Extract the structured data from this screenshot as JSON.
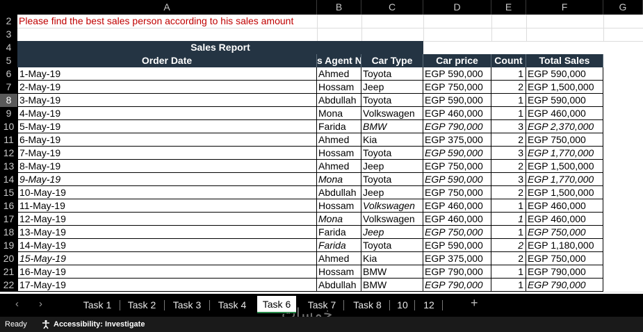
{
  "columns": [
    "A",
    "B",
    "C",
    "D",
    "E",
    "F",
    "G"
  ],
  "instruction": "Please find the best sales person according to his sales amount",
  "report_title": "Sales Report",
  "headers": [
    "Order Date",
    "s Agent N",
    "Car Type",
    "Car price",
    "Count",
    "Total Sales"
  ],
  "rows": [
    {
      "num": "6",
      "date": "1-May-19",
      "agent": "Ahmed",
      "car": "Toyota",
      "price": "EGP 590,000",
      "count": "1",
      "total": "EGP 590,000",
      "it": []
    },
    {
      "num": "7",
      "date": "2-May-19",
      "agent": "Hossam",
      "car": "Jeep",
      "price": "EGP 750,000",
      "count": "2",
      "total": "EGP 1,500,000",
      "it": []
    },
    {
      "num": "8",
      "date": "3-May-19",
      "agent": "Abdullah",
      "car": "Toyota",
      "price": "EGP 590,000",
      "count": "1",
      "total": "EGP 590,000",
      "it": []
    },
    {
      "num": "9",
      "date": "4-May-19",
      "agent": "Mona",
      "car": "Volkswagen",
      "price": "EGP 460,000",
      "count": "1",
      "total": "EGP 460,000",
      "it": []
    },
    {
      "num": "10",
      "date": "5-May-19",
      "agent": "Farida",
      "car": "BMW",
      "price": "EGP 790,000",
      "count": "3",
      "total": "EGP 2,370,000",
      "it": [
        "car",
        "price",
        "total"
      ]
    },
    {
      "num": "11",
      "date": "6-May-19",
      "agent": "Ahmed",
      "car": "Kia",
      "price": "EGP 375,000",
      "count": "2",
      "total": "EGP 750,000",
      "it": []
    },
    {
      "num": "12",
      "date": "7-May-19",
      "agent": "Hossam",
      "car": "Toyota",
      "price": "EGP 590,000",
      "count": "3",
      "total": "EGP 1,770,000",
      "it": [
        "price",
        "total"
      ]
    },
    {
      "num": "13",
      "date": "8-May-19",
      "agent": "Ahmed",
      "car": "Jeep",
      "price": "EGP 750,000",
      "count": "2",
      "total": "EGP 1,500,000",
      "it": []
    },
    {
      "num": "14",
      "date": "9-May-19",
      "agent": "Mona",
      "car": "Toyota",
      "price": "EGP 590,000",
      "count": "3",
      "total": "EGP 1,770,000",
      "it": [
        "date",
        "agent",
        "price",
        "total"
      ]
    },
    {
      "num": "15",
      "date": "10-May-19",
      "agent": "Abdullah",
      "car": "Jeep",
      "price": "EGP 750,000",
      "count": "2",
      "total": "EGP 1,500,000",
      "it": []
    },
    {
      "num": "16",
      "date": "11-May-19",
      "agent": "Hossam",
      "car": "Volkswagen",
      "price": "EGP 460,000",
      "count": "1",
      "total": "EGP 460,000",
      "it": [
        "car"
      ]
    },
    {
      "num": "17",
      "date": "12-May-19",
      "agent": "Mona",
      "car": "Volkswagen",
      "price": "EGP 460,000",
      "count": "1",
      "total": "EGP 460,000",
      "it": [
        "agent",
        "count"
      ]
    },
    {
      "num": "18",
      "date": "13-May-19",
      "agent": "Farida",
      "car": "Jeep",
      "price": "EGP 750,000",
      "count": "1",
      "total": "EGP 750,000",
      "it": [
        "car",
        "price",
        "total"
      ]
    },
    {
      "num": "19",
      "date": "14-May-19",
      "agent": "Farida",
      "car": "Toyota",
      "price": "EGP 590,000",
      "count": "2",
      "total": "EGP 1,180,000",
      "it": [
        "agent",
        "count"
      ]
    },
    {
      "num": "20",
      "date": "15-May-19",
      "agent": "Ahmed",
      "car": "Kia",
      "price": "EGP 375,000",
      "count": "2",
      "total": "EGP 750,000",
      "it": [
        "date"
      ]
    },
    {
      "num": "21",
      "date": "16-May-19",
      "agent": "Hossam",
      "car": "BMW",
      "price": "EGP 790,000",
      "count": "1",
      "total": "EGP 790,000",
      "it": []
    },
    {
      "num": "22",
      "date": "17-May-19",
      "agent": "Abdullah",
      "car": "BMW",
      "price": "EGP 790,000",
      "count": "1",
      "total": "EGP 790,000",
      "it": [
        "price",
        "total"
      ]
    }
  ],
  "selected_row": "8",
  "tabs": [
    "Task 1",
    "Task 2",
    "Task 3",
    "Task 4",
    "Task 6",
    "Task 7",
    "Task 8",
    "10",
    "12"
  ],
  "active_tab": "Task 6",
  "watermark": "خمسات",
  "status": {
    "ready": "Ready",
    "accessibility": "Accessibility: Investigate"
  }
}
